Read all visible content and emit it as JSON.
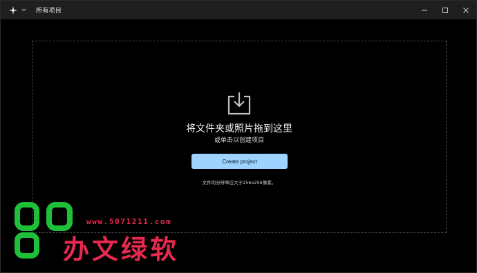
{
  "window": {
    "title": "所有项目",
    "controls": [
      "minimize-icon",
      "maximize-icon",
      "close-icon"
    ]
  },
  "app": {
    "icon": "sparkle-icon",
    "menu_icon": "chevron-down-icon"
  },
  "drop_zone": {
    "icon": "import-tray-icon",
    "title": "将文件夹或照片拖到这里",
    "subtitle": "或单击以创建项目",
    "button_label": "Create project",
    "hint": "文件的分辨率应大于256x256像素。"
  },
  "watermark": {
    "url": "www.5071211.com",
    "name": "办文绿软",
    "colors": {
      "logo": "#1fbf3a",
      "text": "#e8294f"
    }
  },
  "colors": {
    "accent": "#9ed3ff",
    "background": "#000000",
    "titlebar": "#1f1f1f"
  }
}
